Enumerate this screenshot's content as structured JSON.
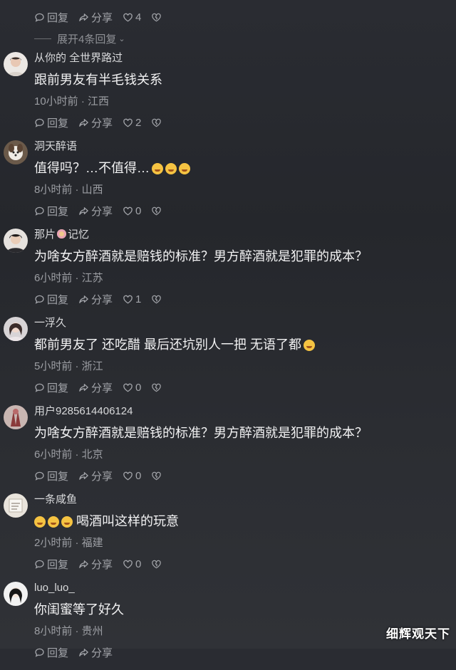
{
  "top_actions": {
    "reply": "回复",
    "share": "分享",
    "likes": "4"
  },
  "expand_label": "展开4条回复",
  "comments": [
    {
      "username": "从你的 全世界路过",
      "text": "跟前男友有半毛钱关系",
      "meta": "10小时前 · 江西",
      "reply": "回复",
      "share": "分享",
      "likes": "2"
    },
    {
      "username": "洞天醉语",
      "text": "值得吗？…不值得…",
      "meta": "8小时前 · 山西",
      "reply": "回复",
      "share": "分享",
      "likes": "0"
    },
    {
      "username_a": "那片",
      "username_b": "记忆",
      "text": "为啥女方醉酒就是赔钱的标准？男方醉酒就是犯罪的成本？",
      "meta": "6小时前 · 江苏",
      "reply": "回复",
      "share": "分享",
      "likes": "1"
    },
    {
      "username": "一浮久",
      "text": "都前男友了 还吃醋 最后还坑别人一把 无语了都",
      "meta": "5小时前 · 浙江",
      "reply": "回复",
      "share": "分享",
      "likes": "0"
    },
    {
      "username": "用户9285614406124",
      "text": "为啥女方醉酒就是赔钱的标准？男方醉酒就是犯罪的成本？",
      "meta": "6小时前 · 北京",
      "reply": "回复",
      "share": "分享",
      "likes": "0"
    },
    {
      "username": "一条咸鱼",
      "text": "喝酒叫这样的玩意",
      "meta": "2小时前 · 福建",
      "reply": "回复",
      "share": "分享",
      "likes": "0"
    },
    {
      "username": "luo_luo_",
      "text": "你闺蜜等了好久",
      "meta": "8小时前 · 贵州",
      "reply": "回复",
      "share": "分享"
    }
  ],
  "watermark": "细辉观天下",
  "colors": {
    "background": "#2a2c32",
    "text": "#f2f2f3",
    "meta": "#9c9ea3",
    "emoji": "#f5c342"
  }
}
